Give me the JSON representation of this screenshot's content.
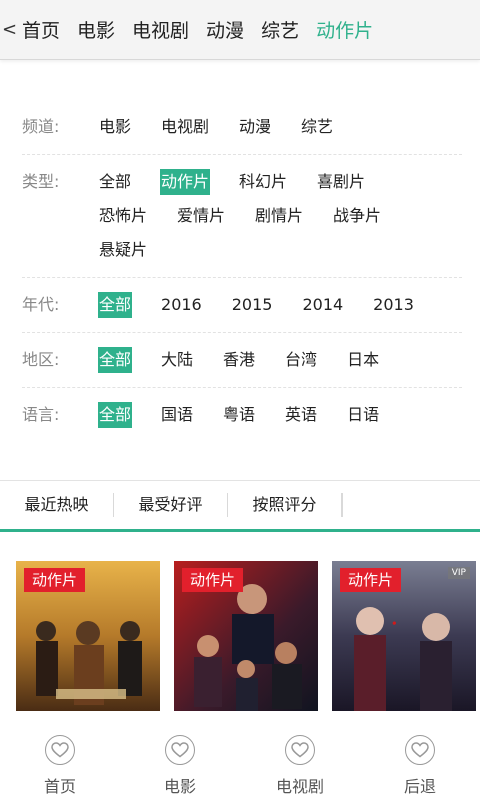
{
  "topnav": {
    "back_label": "<",
    "items": [
      {
        "label": "首页",
        "active": false
      },
      {
        "label": "电影",
        "active": false
      },
      {
        "label": "电视剧",
        "active": false
      },
      {
        "label": "动漫",
        "active": false
      },
      {
        "label": "综艺",
        "active": false
      },
      {
        "label": "动作片",
        "active": true
      }
    ]
  },
  "filters": {
    "channel": {
      "label": "频道:",
      "options": [
        "电影",
        "电视剧",
        "动漫",
        "综艺"
      ],
      "selected": -1
    },
    "genre": {
      "label": "类型:",
      "options": [
        "全部",
        "动作片",
        "科幻片",
        "喜剧片",
        "恐怖片",
        "爱情片",
        "剧情片",
        "战争片",
        "悬疑片"
      ],
      "selected": 1
    },
    "year": {
      "label": "年代:",
      "options": [
        "全部",
        "2016",
        "2015",
        "2014",
        "2013"
      ],
      "selected": 0
    },
    "region": {
      "label": "地区:",
      "options": [
        "全部",
        "大陆",
        "香港",
        "台湾",
        "日本"
      ],
      "selected": 0
    },
    "language": {
      "label": "语言:",
      "options": [
        "全部",
        "国语",
        "粤语",
        "英语",
        "日语"
      ],
      "selected": 0
    }
  },
  "sort": {
    "options": [
      "最近热映",
      "最受好评",
      "按照评分"
    ]
  },
  "posters": [
    {
      "tag": "动作片",
      "vip": "",
      "art": "poster-gold"
    },
    {
      "tag": "动作片",
      "vip": "",
      "art": "poster-red"
    },
    {
      "tag": "动作片",
      "vip": "VIP",
      "art": "poster-dark"
    }
  ],
  "tabbar": [
    {
      "label": "首页",
      "icon": "heart-icon"
    },
    {
      "label": "电影",
      "icon": "heart-icon"
    },
    {
      "label": "电视剧",
      "icon": "heart-icon"
    },
    {
      "label": "后退",
      "icon": "heart-icon"
    }
  ],
  "colors": {
    "accent": "#2fb18c",
    "tag": "#e2202c"
  }
}
